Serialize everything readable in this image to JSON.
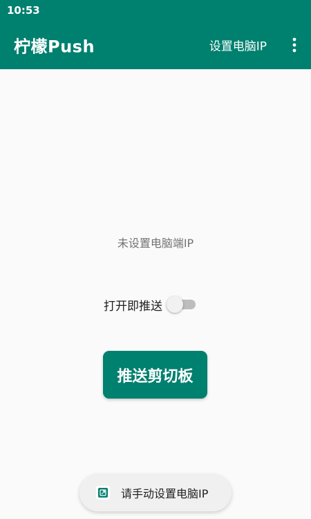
{
  "status_bar": {
    "time": "10:53"
  },
  "app_bar": {
    "title": "柠檬Push",
    "action_label": "设置电脑IP",
    "overflow_icon": "more-vert-icon"
  },
  "main": {
    "ip_status": "未设置电脑端IP",
    "push_on_open_label": "打开即推送",
    "push_on_open_enabled": false,
    "push_button_label": "推送剪切板"
  },
  "toast": {
    "icon": "app-icon",
    "message": "请手动设置电脑IP"
  },
  "colors": {
    "primary": "#00806f",
    "background": "#fafafa",
    "secondary_text": "#737373",
    "switch_track_off": "#bdbdbd"
  }
}
